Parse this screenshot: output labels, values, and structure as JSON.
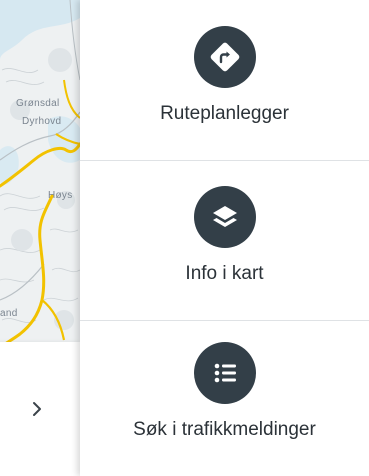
{
  "map": {
    "labels": [
      "Grønsdal",
      "Dyrhovd",
      "Høys",
      "and"
    ]
  },
  "menu": {
    "items": [
      {
        "label": "Ruteplanlegger",
        "icon": "route-planner-icon"
      },
      {
        "label": "Info i kart",
        "icon": "layers-icon"
      },
      {
        "label": "Søk i trafikkmeldinger",
        "icon": "list-icon"
      }
    ]
  },
  "collapse": {
    "icon": "chevron-right-icon"
  },
  "colors": {
    "icon_circle": "#333f48",
    "road_yellow": "#f2c200",
    "water": "#cfe4ef"
  }
}
